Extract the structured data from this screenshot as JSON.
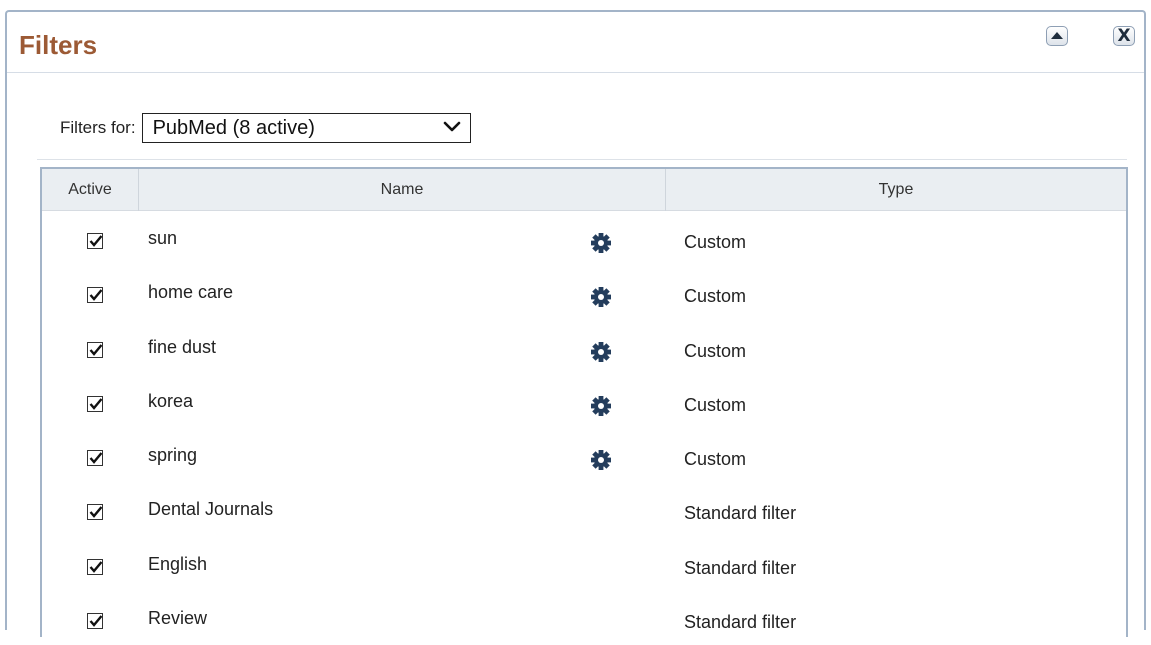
{
  "panel": {
    "title": "Filters"
  },
  "header_buttons": {
    "collapse_icon": "triangle-up-icon",
    "close_icon": "close-x-icon",
    "close_glyph": "X"
  },
  "filters_for": {
    "label": "Filters for:",
    "selected": "PubMed (8 active)"
  },
  "table": {
    "columns": [
      "Active",
      "Name",
      "Type"
    ],
    "rows": [
      {
        "active": true,
        "name": "sun",
        "has_settings": true,
        "type": "Custom"
      },
      {
        "active": true,
        "name": "home care",
        "has_settings": true,
        "type": "Custom"
      },
      {
        "active": true,
        "name": "fine dust",
        "has_settings": true,
        "type": "Custom"
      },
      {
        "active": true,
        "name": "korea",
        "has_settings": true,
        "type": "Custom"
      },
      {
        "active": true,
        "name": "spring",
        "has_settings": true,
        "type": "Custom"
      },
      {
        "active": true,
        "name": "Dental Journals",
        "has_settings": false,
        "type": "Standard filter"
      },
      {
        "active": true,
        "name": "English",
        "has_settings": false,
        "type": "Standard filter"
      },
      {
        "active": true,
        "name": "Review",
        "has_settings": false,
        "type": "Standard filter"
      }
    ]
  },
  "colors": {
    "title": "#9c5a35",
    "gear": "#243d5c",
    "border": "#a3b4c8",
    "header_bg": "#eaeef2"
  }
}
